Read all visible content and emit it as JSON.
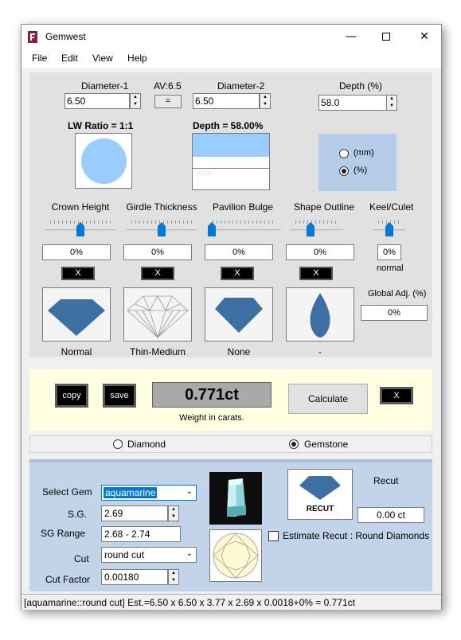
{
  "window": {
    "title": "Gemwest"
  },
  "menu": [
    "File",
    "Edit",
    "View",
    "Help"
  ],
  "dims": {
    "diameter1_label": "Diameter-1",
    "diameter1_value": "6.50",
    "av_label": "AV:6.5",
    "equal_btn": "=",
    "diameter2_label": "Diameter-2",
    "diameter2_value": "6.50",
    "depth_label": "Depth (%)",
    "depth_value": "58.0",
    "lw_ratio": "LW Ratio = 1:1",
    "depth_display": "Depth = 58.00%",
    "depth_bar_label": "60%",
    "unit_mm": "(mm)",
    "unit_pct": "(%)",
    "depth_fill_fraction": 0.42
  },
  "adjust": [
    {
      "label": "Crown Height",
      "value": "0%",
      "x_btn": "X",
      "shape_caption": "Normal",
      "slider_pos": 0.5
    },
    {
      "label": "Girdle Thickness",
      "value": "0%",
      "x_btn": "X",
      "shape_caption": "Thin-Medium",
      "slider_pos": 0.5
    },
    {
      "label": "Pavilion Bulge",
      "value": "0%",
      "x_btn": "X",
      "shape_caption": "None",
      "slider_pos": 0.0
    },
    {
      "label": "Shape Outline",
      "value": "0%",
      "x_btn": "X",
      "shape_caption": "-",
      "slider_pos": 0.35
    }
  ],
  "keel": {
    "label": "Keel/Culet",
    "value": "0%",
    "caption": "normal"
  },
  "global": {
    "label": "Global Adj. (%)",
    "value": "0%"
  },
  "weight": {
    "copy": "copy",
    "save": "save",
    "value": "0.771ct",
    "caption": "Weight in carats.",
    "calculate": "Calculate",
    "x_btn": "X"
  },
  "type": {
    "diamond": "Diamond",
    "gemstone": "Gemstone",
    "selected": "Gemstone"
  },
  "gem": {
    "select_label": "Select Gem",
    "select_value": "aquamarine",
    "sg_label": "S.G.",
    "sg_value": "2.69",
    "sg_range_label": "SG Range",
    "sg_range_value": "2.68 - 2.74",
    "cut_label": "Cut",
    "cut_value": "round cut",
    "cut_factor_label": "Cut Factor",
    "cut_factor_value": "0.00180",
    "recut_title": "Recut",
    "recut_btn": "RECUT",
    "recut_value": "0.00 ct",
    "estimate_label": "Estimate Recut : Round Diamonds"
  },
  "status": "[aquamarine::round cut] Est.=6.50 x 6.50 x 3.77 x 2.69 x 0.0018+0% = 0.771ct",
  "colors": {
    "accent": "#99ccff",
    "shape_blue": "#3e6fa3",
    "selected_bg": "#0078d7"
  }
}
